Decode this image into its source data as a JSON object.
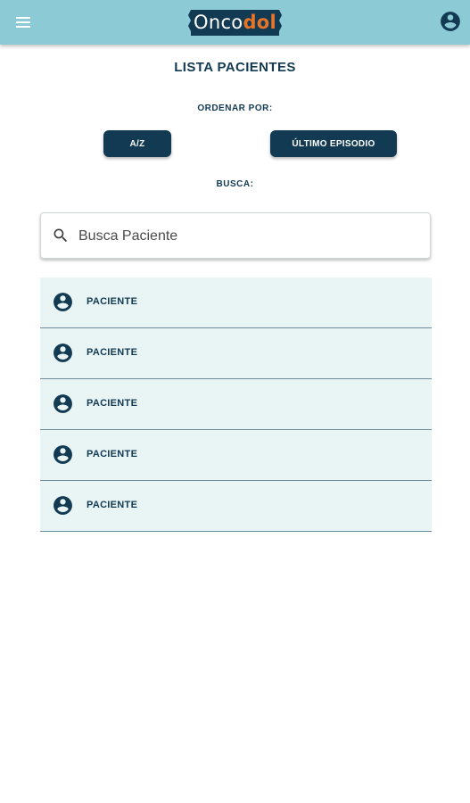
{
  "header": {
    "logo_part1": "Onco",
    "logo_part2": "dol"
  },
  "page": {
    "title": "LISTA PACIENTES",
    "sort_label": "ORDENAR POR:",
    "sort_buttons": [
      "A/Z",
      "ÚLTIMO EPISODIO"
    ],
    "search_label": "BUSCA:"
  },
  "search": {
    "placeholder": "Busca Paciente",
    "value": ""
  },
  "patients": [
    {
      "name": "PACIENTE"
    },
    {
      "name": "PACIENTE"
    },
    {
      "name": "PACIENTE"
    },
    {
      "name": "PACIENTE"
    },
    {
      "name": "PACIENTE"
    }
  ],
  "icons": {
    "menu": "menu-icon",
    "account": "account-circle-icon",
    "search": "search-icon",
    "patient": "account-circle-icon"
  },
  "colors": {
    "appbar": "#8ccbd6",
    "primary": "#123a52",
    "accent": "#e8742a",
    "list_bg": "#e9f4f5"
  }
}
